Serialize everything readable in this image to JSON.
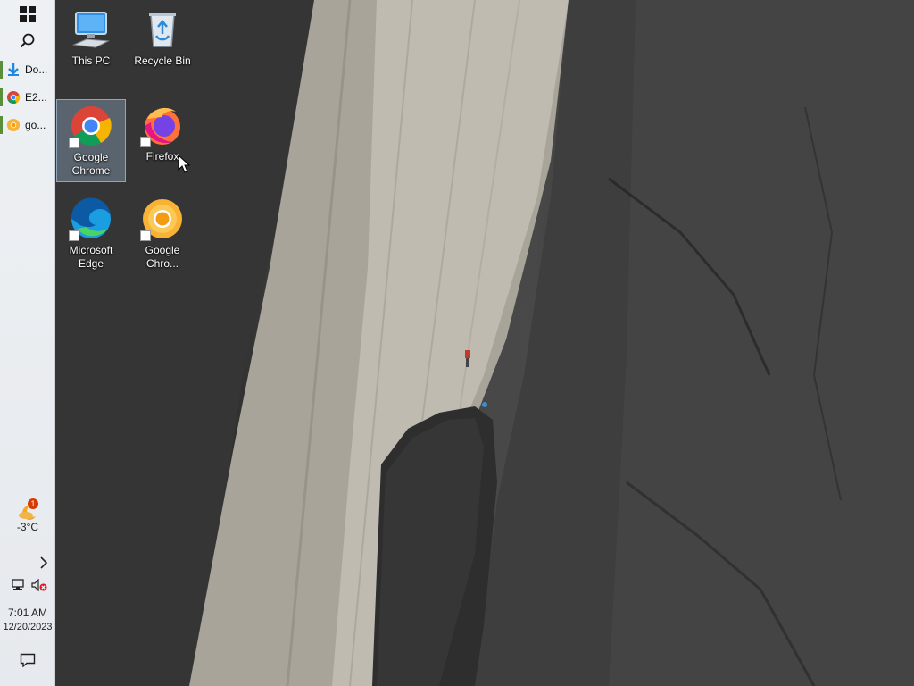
{
  "desktop": {
    "icons": [
      {
        "label": "This PC"
      },
      {
        "label": "Recycle Bin"
      },
      {
        "label": "Google Chrome"
      },
      {
        "label": "Firefox"
      },
      {
        "label": "Microsoft Edge"
      },
      {
        "label": "Google Chro..."
      }
    ]
  },
  "taskbar": {
    "start_icon": "windows-logo-icon",
    "search_icon": "search-icon",
    "apps": [
      {
        "label": "Do...",
        "icon": "download-arrow-icon"
      },
      {
        "label": "E2...",
        "icon": "chrome-icon"
      },
      {
        "label": "go...",
        "icon": "chrome-canary-icon"
      }
    ],
    "weather": {
      "badge": "1",
      "temp": "-3°C"
    },
    "tray": {
      "chevron_icon": "chevron-right-icon",
      "network_icon": "network-icon",
      "volume_icon": "volume-muted-icon"
    },
    "clock": {
      "time": "7:01 AM",
      "date": "12/20/2023"
    },
    "notification_icon": "action-center-icon"
  },
  "colors": {
    "taskbar_bg": "#eef1f4",
    "running_indicator": "#5a8f3a",
    "badge": "#d83b01",
    "selection": "#a0bedc"
  }
}
